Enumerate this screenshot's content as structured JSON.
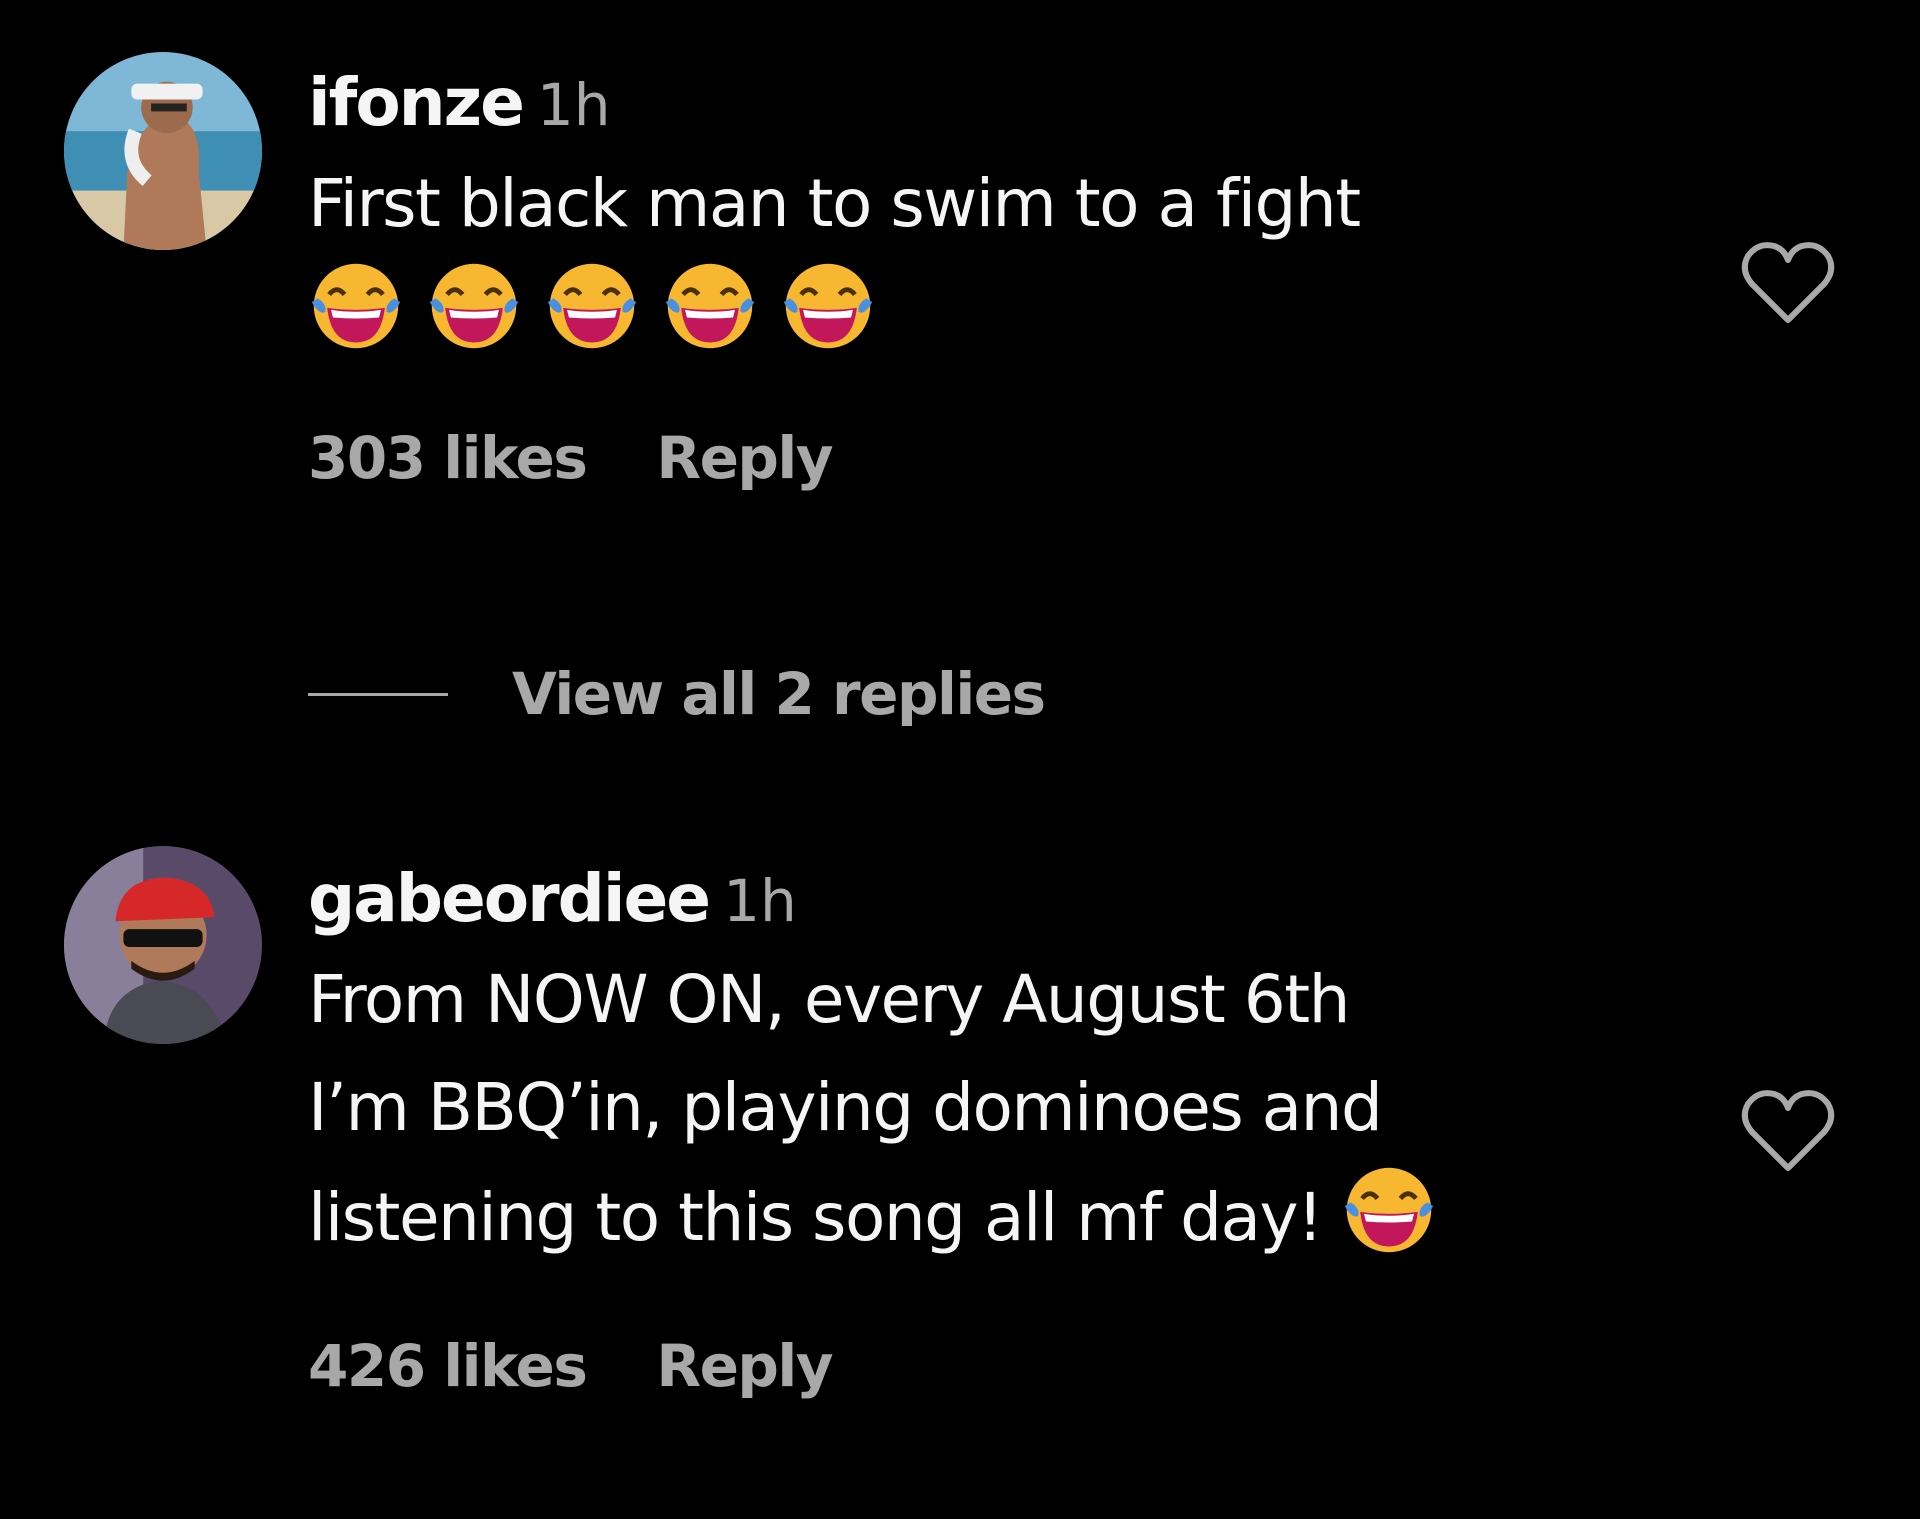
{
  "comments": [
    {
      "username": "ifonze",
      "time": "1h",
      "text": "First black man to swim to a fight",
      "emoji_count": 5,
      "emoji_name": "face-with-tears-of-joy",
      "likes": "303 likes",
      "reply_label": "Reply",
      "avatar": "beach-photo-avatar"
    },
    {
      "username": "gabeordiee",
      "time": "1h",
      "text_lines": [
        "From NOW ON, every August 6th",
        "I’m BBQ’in, playing dominoes and",
        "listening to this song all mf day!"
      ],
      "emoji_name": "face-with-tears-of-joy",
      "likes": "426 likes",
      "reply_label": "Reply",
      "avatar": "red-cap-sunglasses-avatar"
    }
  ],
  "view_replies_label": "View all 2 replies",
  "colors": {
    "background": "#000000",
    "primary_text": "#f5f5f5",
    "secondary_text": "#a8a8a8",
    "emoji_face": "#f7b731",
    "emoji_mouth": "#c2185b",
    "emoji_tears": "#4a90e2"
  },
  "icons": {
    "like": "heart-outline-icon"
  }
}
